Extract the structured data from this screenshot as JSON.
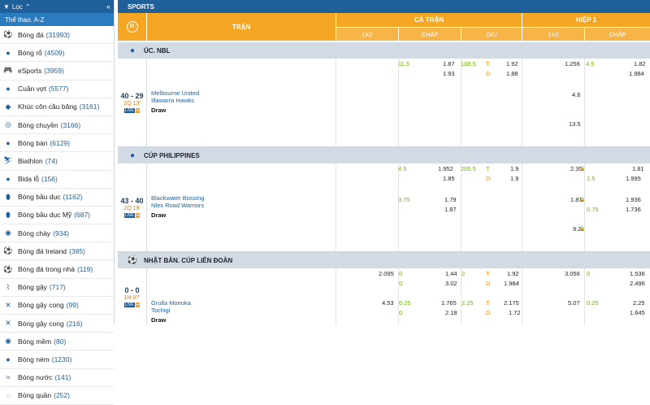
{
  "sidebar": {
    "filter_label": "Lọc",
    "az_title": "Thể thao. A-Z",
    "items": [
      {
        "label": "Bóng đá",
        "count": "(31993)",
        "icon": "soccer-ball-icon"
      },
      {
        "label": "Bóng rổ",
        "count": "(4509)",
        "icon": "basketball-icon"
      },
      {
        "label": "eSports",
        "count": "(3959)",
        "icon": "gamepad-icon"
      },
      {
        "label": "Cuần vợt",
        "count": "(5577)",
        "icon": "tennis-ball-icon"
      },
      {
        "label": "Khúc côn cầu băng",
        "count": "(3161)",
        "icon": "ice-hockey-icon"
      },
      {
        "label": "Bóng chuyền",
        "count": "(3166)",
        "icon": "volleyball-icon"
      },
      {
        "label": "Bóng bàn",
        "count": "(6129)",
        "icon": "table-tennis-icon"
      },
      {
        "label": "Biathlon",
        "count": "(74)",
        "icon": "biathlon-icon"
      },
      {
        "label": "Bida lỗ",
        "count": "(156)",
        "icon": "billiards-icon"
      },
      {
        "label": "Bóng bầu dục",
        "count": "(1162)",
        "icon": "rugby-ball-icon"
      },
      {
        "label": "Bóng bầu dục Mỹ",
        "count": "(687)",
        "icon": "american-football-icon"
      },
      {
        "label": "Bóng chày",
        "count": "(934)",
        "icon": "baseball-icon"
      },
      {
        "label": "Bóng đá Ireland",
        "count": "(385)",
        "icon": "gaelic-football-icon"
      },
      {
        "label": "Bóng đá trong nhà",
        "count": "(119)",
        "icon": "futsal-icon"
      },
      {
        "label": "Bóng gậy",
        "count": "(717)",
        "icon": "cricket-icon"
      },
      {
        "label": "Bóng gậy cong",
        "count": "(99)",
        "icon": "hurling-icon"
      },
      {
        "label": "Bóng gậy cong",
        "count": "(216)",
        "icon": "field-hockey-icon"
      },
      {
        "label": "Bóng mềm",
        "count": "(80)",
        "icon": "softball-icon"
      },
      {
        "label": "Bóng ném",
        "count": "(1230)",
        "icon": "handball-icon"
      },
      {
        "label": "Bóng nước",
        "count": "(141)",
        "icon": "water-polo-icon"
      },
      {
        "label": "Bóng quần",
        "count": "(252)",
        "icon": "squash-icon"
      }
    ]
  },
  "main": {
    "title": "SPORTS",
    "header": {
      "tran": "TRẬN",
      "ca_tran": "CẢ TRẬN",
      "hiep1": "HIỆP 1",
      "tx2": "1X2",
      "chap": "CHẤP",
      "ou": "O/U"
    },
    "leagues": [
      {
        "name": "ÚC. NBL",
        "icon": "basketball-icon",
        "match": {
          "score": "40 - 29",
          "period": "2Q 13'",
          "team1": "Melbourne United",
          "team2": "Illawarra Hawks",
          "draw": "Draw",
          "ft_hdp_line": "11.5",
          "ft_hdp_odds1": "1.87",
          "ft_hdp_odds2": "1.93",
          "ft_ou_line": "188.5",
          "ft_ou_t": "T",
          "ft_ou_d": "D",
          "ft_ou_odds1": "1.92",
          "ft_ou_odds2": "1.88",
          "h1_1x2_a": "1.256",
          "h1_1x2_b": "4.6",
          "h1_1x2_c": "13.5",
          "h1_hdp_line": "4.5",
          "h1_hdp_odds1": "1.82",
          "h1_hdp_odds2": "1.984"
        }
      },
      {
        "name": "CÚP PHILIPPINES",
        "icon": "basketball-icon",
        "match": {
          "score": "43 - 40",
          "period": "2Q 19'",
          "team1": "Blackwater Bossing",
          "team2": "Nlex Road Warriors",
          "draw": "Draw",
          "ft_hdp_line1": "4.5",
          "ft_hdp_line2": "3.75",
          "ft_hdp_odds1": "1.952",
          "ft_hdp_odds2": "1.85",
          "ft_hdp_odds3": "1.79",
          "ft_hdp_odds4": "1.87",
          "ft_ou_line": "205.5",
          "ft_ou_t": "T",
          "ft_ou_d": "D",
          "ft_ou_odds1": "1.9",
          "ft_ou_odds2": "1.9",
          "h1_1x2_a": "2.35",
          "h1_1x2_b": "1.81",
          "h1_1x2_c": "9.2",
          "h1_hdp_line1": "1.5",
          "h1_hdp_line2": "0.75",
          "h1_hdp_odds1": "1.81",
          "h1_hdp_odds2": "1.995",
          "h1_hdp_odds3": "1.936",
          "h1_hdp_odds4": "1.736"
        }
      },
      {
        "name": "NHẬT BẢN. CÚP LIÊN ĐOÀN",
        "icon": "soccer-ball-icon",
        "match": {
          "score": "0 - 0",
          "period": "1H 07'",
          "team1": "Grulla Morioka",
          "team2": "Tochigi",
          "draw": "Draw",
          "ft_1x2_a": "2.095",
          "ft_1x2_b": "4.53",
          "ft_hdp_line1": "0",
          "ft_hdp_line2": "0",
          "ft_hdp_line3": "0.25",
          "ft_hdp_line4": "0",
          "ft_hdp_odds1": "1.44",
          "ft_hdp_odds2": "3.02",
          "ft_hdp_odds3": "1.765",
          "ft_hdp_odds4": "2.18",
          "ft_ou_line1": "2",
          "ft_ou_line2": "2.25",
          "ft_ou_t": "T",
          "ft_ou_d": "D",
          "ft_ou_odds1": "1.92",
          "ft_ou_odds2": "1.984",
          "ft_ou_odds3": "2.175",
          "ft_ou_odds4": "1.72",
          "h1_1x2_a": "3.056",
          "h1_1x2_b": "5.07",
          "h1_hdp_line1": "0",
          "h1_hdp_line2": "0.25",
          "h1_hdp_odds1": "1.536",
          "h1_hdp_odds2": "2.496",
          "h1_hdp_odds3": "2.25",
          "h1_hdp_odds4": "1.645"
        }
      }
    ]
  }
}
